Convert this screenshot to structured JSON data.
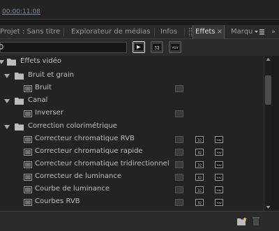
{
  "timecode": "00:00:11:08",
  "tabs": [
    {
      "label": "Projet : Sans titre"
    },
    {
      "label": "Explorateur de médias"
    },
    {
      "label": "Infos"
    },
    {
      "label": "Effets"
    },
    {
      "label": "Marqu"
    }
  ],
  "tab_close_glyph": "×",
  "overflow_glyph": "»",
  "search": {
    "value": "",
    "placeholder": ""
  },
  "filters": [
    {
      "name": "accelerated-effects",
      "icon": "accelerate-icon",
      "active": true
    },
    {
      "name": "32-bit-color",
      "icon": "32bit-icon",
      "active": false
    },
    {
      "name": "yuv",
      "icon": "yuv-icon",
      "active": false
    }
  ],
  "tree": {
    "root": {
      "label": "Effets vidéo",
      "expanded": true
    },
    "groups": [
      {
        "label": "Bruit et grain",
        "expanded": true,
        "items": [
          {
            "label": "Bruit",
            "badges": {
              "accel": false,
              "bit32": false,
              "yuv": false
            }
          }
        ]
      },
      {
        "label": "Canal",
        "expanded": true,
        "items": [
          {
            "label": "Inverser",
            "badges": {
              "accel": false,
              "bit32": false,
              "yuv": false
            }
          }
        ]
      },
      {
        "label": "Correction colorimétrique",
        "expanded": true,
        "items": [
          {
            "label": "Correcteur chromatique RVB",
            "badges": {
              "accel": false,
              "bit32": true,
              "yuv": true
            }
          },
          {
            "label": "Correcteur chromatique rapide",
            "badges": {
              "accel": false,
              "bit32": true,
              "yuv": true
            }
          },
          {
            "label": "Correcteur chromatique tridirectionnel",
            "badges": {
              "accel": false,
              "bit32": true,
              "yuv": true
            }
          },
          {
            "label": "Correcteur de luminance",
            "badges": {
              "accel": false,
              "bit32": true,
              "yuv": true
            }
          },
          {
            "label": "Courbe de luminance",
            "badges": {
              "accel": false,
              "bit32": true,
              "yuv": true
            }
          },
          {
            "label": "Courbes RVB",
            "badges": {
              "accel": false,
              "bit32": true,
              "yuv": true
            }
          }
        ]
      }
    ]
  },
  "colors": {
    "panel_bg": "#232323",
    "active_tab": "#383838",
    "text": "#bfbfbf",
    "timecode": "#7e8a99"
  }
}
